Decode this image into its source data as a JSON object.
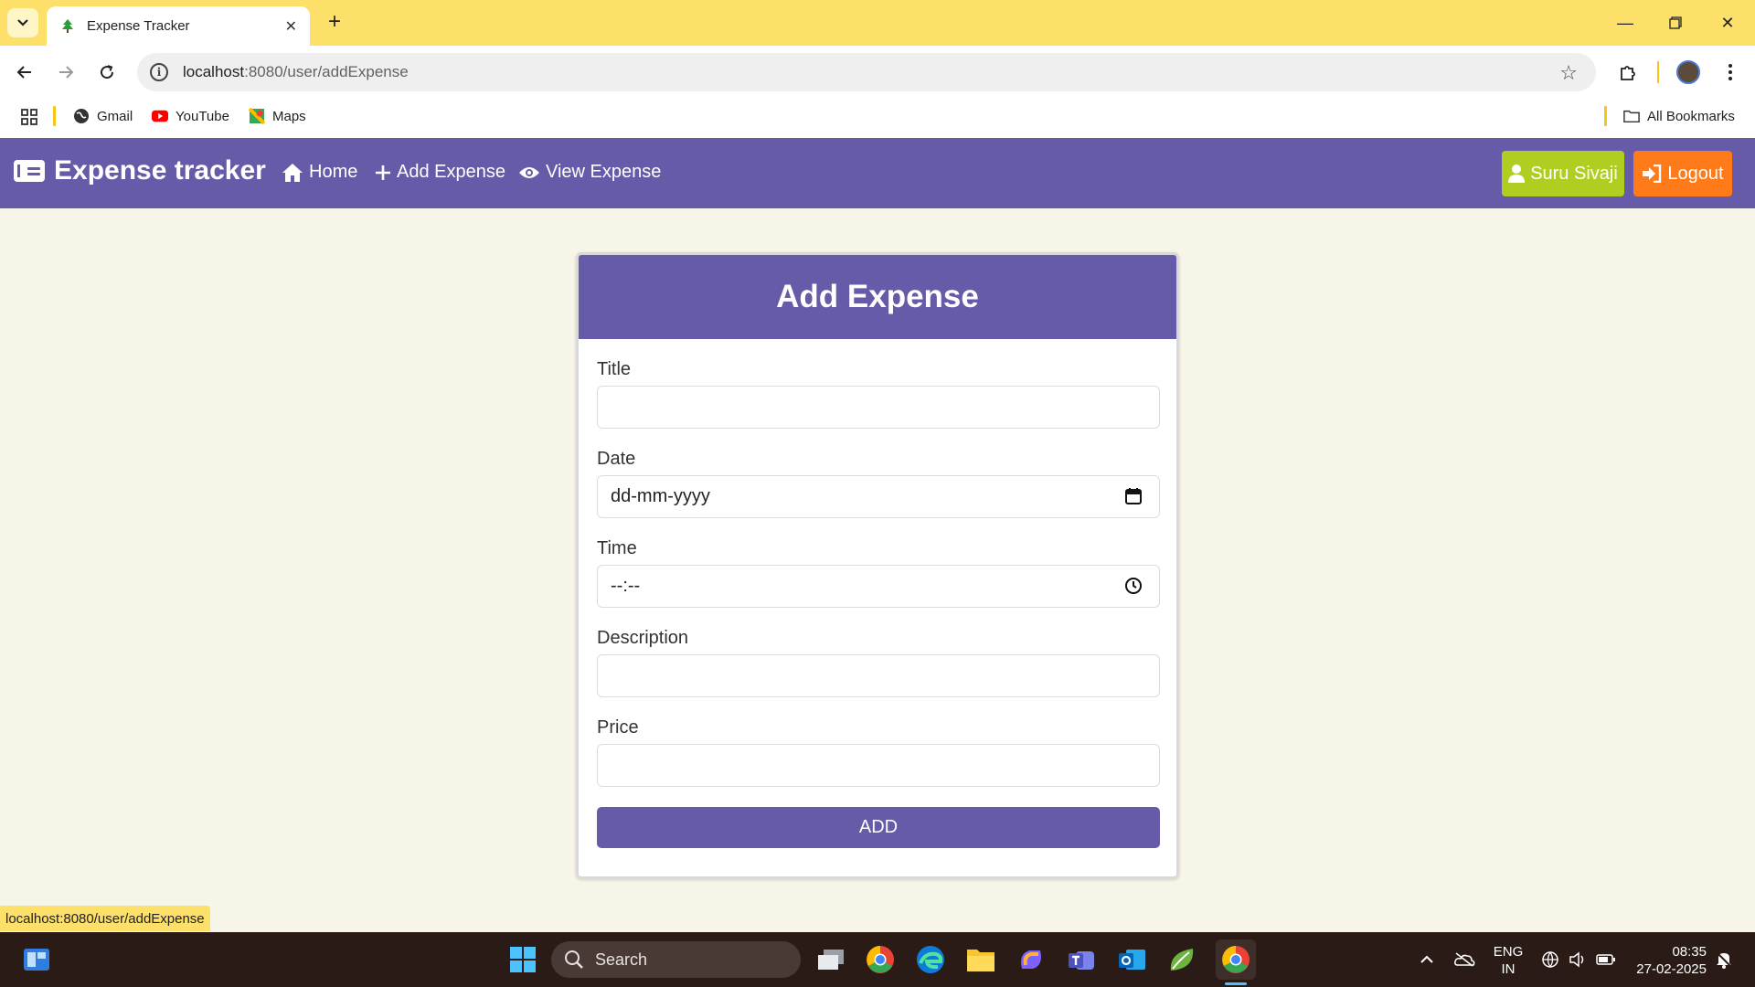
{
  "browser": {
    "tab_title": "Expense Tracker",
    "url_host": "localhost",
    "url_path": ":8080/user/addExpense",
    "bookmarks": [
      {
        "label": "Gmail"
      },
      {
        "label": "YouTube"
      },
      {
        "label": "Maps"
      }
    ],
    "all_bookmarks": "All Bookmarks",
    "status_url": "localhost:8080/user/addExpense"
  },
  "app": {
    "brand": "Expense tracker",
    "nav": [
      {
        "label": "Home"
      },
      {
        "label": "Add Expense"
      },
      {
        "label": "View Expense"
      }
    ],
    "user_button": "Suru Sivaji",
    "logout_button": "Logout",
    "colors": {
      "primary": "#665ba9",
      "user": "#aecf22",
      "logout": "#ff7a18",
      "background": "#f7f5e8"
    }
  },
  "form": {
    "heading": "Add Expense",
    "fields": [
      {
        "label": "Title",
        "value": ""
      },
      {
        "label": "Date",
        "value": "dd-mm-yyyy"
      },
      {
        "label": "Time",
        "value": "--:--"
      },
      {
        "label": "Description",
        "value": ""
      },
      {
        "label": "Price",
        "value": ""
      }
    ],
    "submit": "ADD"
  },
  "taskbar": {
    "search": "Search",
    "lang_top": "ENG",
    "lang_bottom": "IN",
    "time": "08:35",
    "date": "27-02-2025"
  }
}
